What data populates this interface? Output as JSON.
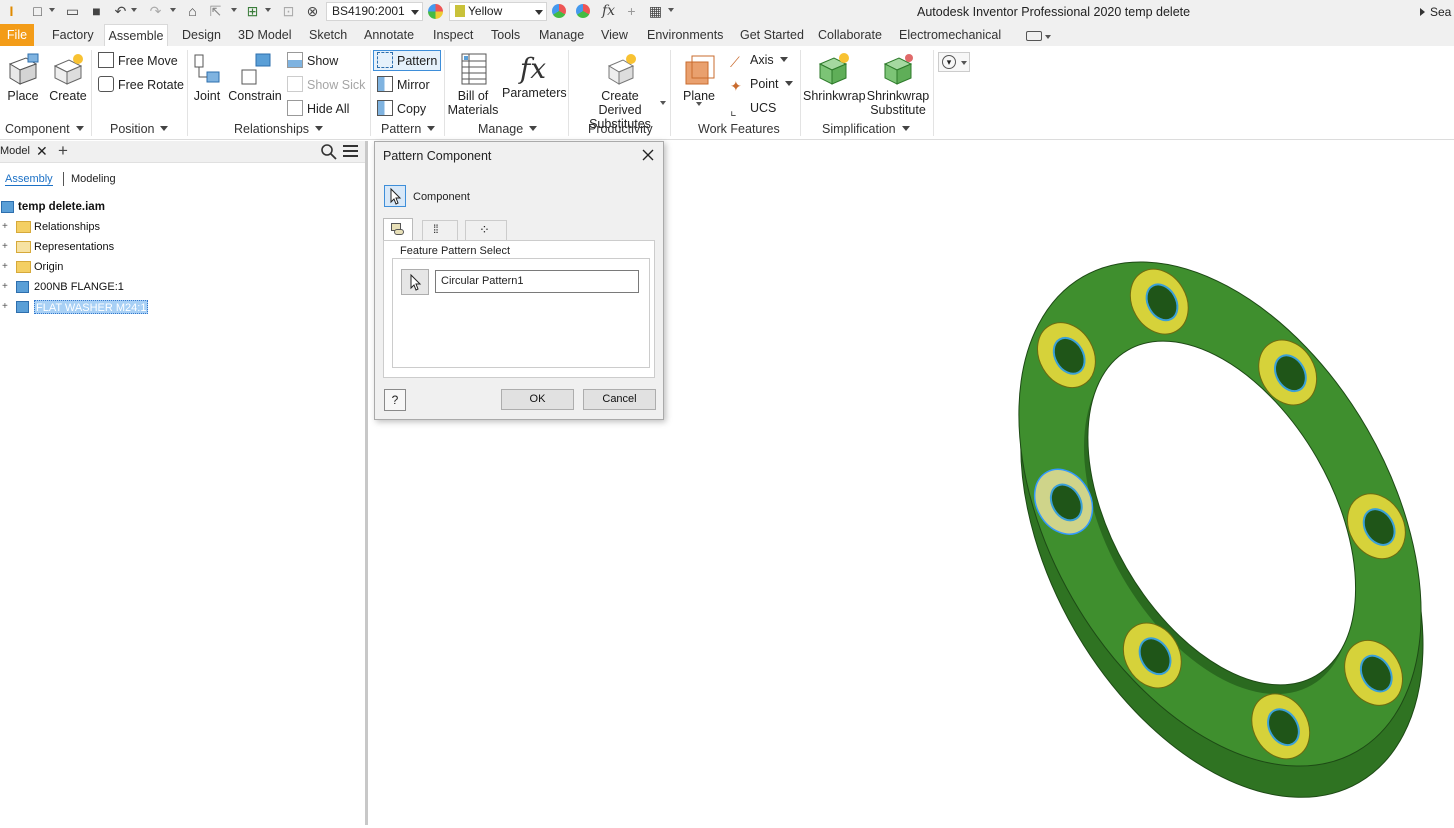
{
  "qat": {
    "material_combo": "BS4190:2001",
    "appearance_combo": "Yellow",
    "fx_label": "fx"
  },
  "window": {
    "title": "Autodesk Inventor Professional 2020   temp delete",
    "search_stub": "Sea"
  },
  "tabs": [
    "File",
    "Factory",
    "Assemble",
    "Design",
    "3D Model",
    "Sketch",
    "Annotate",
    "Inspect",
    "Tools",
    "Manage",
    "View",
    "Environments",
    "Get Started",
    "Collaborate",
    "Electromechanical"
  ],
  "ribbon": {
    "component": {
      "place": "Place",
      "create": "Create",
      "group": "Component"
    },
    "position": {
      "free_move": "Free Move",
      "free_rotate": "Free Rotate",
      "group": "Position"
    },
    "relationships": {
      "joint": "Joint",
      "constrain": "Constrain",
      "show": "Show",
      "show_sick": "Show Sick",
      "hide_all": "Hide All",
      "group": "Relationships"
    },
    "pattern": {
      "pattern": "Pattern",
      "mirror": "Mirror",
      "copy": "Copy",
      "group": "Pattern"
    },
    "manage": {
      "bom_line1": "Bill of",
      "bom_line2": "Materials",
      "parameters": "Parameters",
      "fx": "fx",
      "group": "Manage"
    },
    "productivity": {
      "cds_line1": "Create Derived",
      "cds_line2": "Substitutes",
      "group": "Productivity"
    },
    "work_features": {
      "plane": "Plane",
      "axis": "Axis",
      "point": "Point",
      "ucs": "UCS",
      "group": "Work Features"
    },
    "simplification": {
      "shrinkwrap": "Shrinkwrap",
      "sws_line1": "Shrinkwrap",
      "sws_line2": "Substitute",
      "group": "Simplification"
    }
  },
  "browser": {
    "tab": "Model",
    "close": "✕",
    "add": "+",
    "mode_assembly": "Assembly",
    "mode_modeling": "Modeling",
    "root": "temp delete.iam",
    "items": [
      {
        "label": "Relationships",
        "type": "folder"
      },
      {
        "label": "Representations",
        "type": "folder"
      },
      {
        "label": "Origin",
        "type": "folder"
      },
      {
        "label": "200NB FLANGE:1",
        "type": "component"
      },
      {
        "label": "FLAT WASHER M24:1",
        "type": "component",
        "selected": true
      }
    ]
  },
  "dialog": {
    "title": "Pattern Component",
    "component_label": "Component",
    "group_title": "Feature Pattern Select",
    "feature_value": "Circular Pattern1",
    "help": "?",
    "ok": "OK",
    "cancel": "Cancel"
  },
  "colors": {
    "file_tab": "#f39c18",
    "flange": "#3f8f2e",
    "washer": "#d6d23a",
    "selection": "#3399ff"
  }
}
